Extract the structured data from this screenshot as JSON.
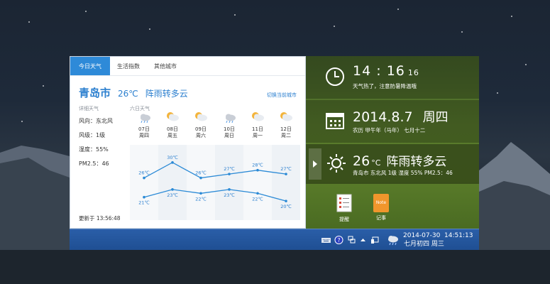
{
  "tabs": [
    "今日天气",
    "生活指数",
    "其他城市"
  ],
  "today": {
    "city": "青岛市",
    "temp": "26℃",
    "condition": "阵雨转多云",
    "switch_city": "切换当前城市",
    "details_heading": "详细天气",
    "wind_direction": "风向：东北风",
    "wind_level": "风级：1级",
    "humidity": "湿度：55%",
    "pm25": "PM2.5：46",
    "updated": "更新于 13:56:48"
  },
  "forecast": {
    "heading": "六日天气",
    "days": [
      {
        "date": "07日",
        "dow": "周四",
        "icon": "rain-cloud-icon"
      },
      {
        "date": "08日",
        "dow": "周五",
        "icon": "partly-cloudy-icon"
      },
      {
        "date": "09日",
        "dow": "周六",
        "icon": "partly-cloudy-icon"
      },
      {
        "date": "10日",
        "dow": "周日",
        "icon": "rain-cloud-icon"
      },
      {
        "date": "11日",
        "dow": "周一",
        "icon": "partly-cloudy-icon"
      },
      {
        "date": "12日",
        "dow": "周二",
        "icon": "partly-cloudy-icon"
      }
    ],
    "high_labels": [
      "26℃",
      "30℃",
      "26℃",
      "27℃",
      "28℃",
      "27℃"
    ],
    "low_labels": [
      "21℃",
      "23℃",
      "22℃",
      "23℃",
      "22℃",
      "20℃"
    ]
  },
  "chart_data": {
    "type": "line",
    "categories": [
      "07日",
      "08日",
      "09日",
      "10日",
      "11日",
      "12日"
    ],
    "series": [
      {
        "values": [
          26,
          30,
          26,
          27,
          28,
          27
        ]
      },
      {
        "values": [
          21,
          23,
          22,
          23,
          22,
          20
        ]
      }
    ],
    "ylim": [
      18,
      32
    ],
    "colors": [
      "#2b8ad6",
      "#2b8ad6"
    ]
  },
  "clock": {
    "hour": "14",
    "sep": ":",
    "minute": "16",
    "second": "16",
    "hint": "天气热了，注意防暑降温哦"
  },
  "date": {
    "date": "2014.8.7",
    "weekday": "周四",
    "lunar": "农历 甲午年（马年） 七月十二"
  },
  "weather_widget": {
    "temp": "26",
    "unit": "°C",
    "condition": "阵雨转多云",
    "summary": "青岛市  东北风 1级  湿度 55%   PM2.5：46"
  },
  "apps": [
    {
      "label": "提醒",
      "icon": "reminder-list-icon"
    },
    {
      "label": "记事",
      "icon": "note-icon",
      "tile_text": "Note"
    }
  ],
  "taskbar": {
    "date": "2014-07-30",
    "time": "14:51:13",
    "lunar": "七月初四  周三"
  }
}
